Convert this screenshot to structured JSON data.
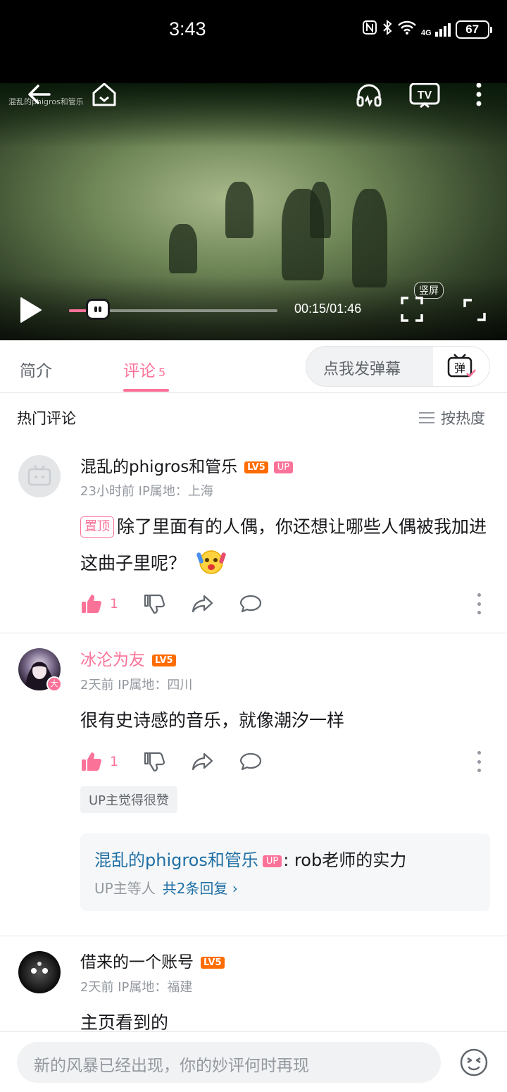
{
  "status_bar": {
    "time": "3:43",
    "network": "4G",
    "battery": "67"
  },
  "video": {
    "watermark": "混乱的phigros和管乐",
    "current_time": "00:15",
    "total_time": "01:46",
    "progress_fraction": 0.14,
    "vertical_label": "竖屏"
  },
  "tabs": [
    {
      "label": "简介"
    },
    {
      "label": "评论",
      "count": "5"
    }
  ],
  "danmaku": {
    "placeholder": "点我发弹幕",
    "button": "弹"
  },
  "section": {
    "title": "热门评论",
    "sort_label": "按热度"
  },
  "comments": [
    {
      "username": "混乱的phigros和管乐",
      "level": "LV5",
      "up_badge": "UP",
      "time": "23小时前",
      "ip": "IP属地：上海",
      "pinned_label": "置顶",
      "text": "除了里面有的人偶，你还想让哪些人偶被我加进这曲子里呢？",
      "likes": "1"
    },
    {
      "username": "冰沦为友",
      "level": "LV5",
      "time": "2天前",
      "ip": "IP属地：四川",
      "text": "很有史诗感的音乐，就像潮汐一样",
      "likes": "1",
      "up_liked": "UP主觉得很赞",
      "reply": {
        "name": "混乱的phigros和管乐",
        "badge": "UP",
        "text": ": rob老师的实力",
        "by": "UP主等人",
        "more": "共2条回复 ›"
      }
    },
    {
      "username": "借来的一个账号",
      "level": "LV5",
      "time": "2天前",
      "ip": "IP属地：福建",
      "text": "主页看到的"
    }
  ],
  "bottom": {
    "placeholder": "新的风暴已经出现，你的妙评何时再现"
  },
  "colors": {
    "accent": "#fb7299",
    "link": "#1e6fa5",
    "level": "#ff6c00"
  }
}
